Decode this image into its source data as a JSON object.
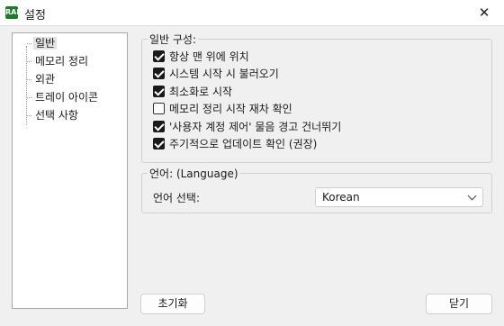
{
  "window": {
    "title": "설정",
    "app_icon_text": "RAM",
    "close_glyph": "✕"
  },
  "sidebar": {
    "items": [
      {
        "label": "일반",
        "selected": true
      },
      {
        "label": "메모리 정리",
        "selected": false
      },
      {
        "label": "외관",
        "selected": false
      },
      {
        "label": "트레이 아이콘",
        "selected": false
      },
      {
        "label": "선택 사항",
        "selected": false
      }
    ]
  },
  "general": {
    "legend": "일반 구성:",
    "options": [
      {
        "label": "항상 맨 위에 위치",
        "checked": true
      },
      {
        "label": "시스템 시작 시 불러오기",
        "checked": true
      },
      {
        "label": "최소화로 시작",
        "checked": true
      },
      {
        "label": "메모리 정리 시작 재차 확인",
        "checked": false
      },
      {
        "label": "'사용자 계정 제어' 물음 경고 건너뛰기",
        "checked": true
      },
      {
        "label": "주기적으로 업데이트 확인 (권장)",
        "checked": true
      }
    ]
  },
  "language": {
    "legend": "언어: (Language)",
    "label": "언어 선택:",
    "selected": "Korean"
  },
  "buttons": {
    "reset": "초기화",
    "close": "닫기"
  },
  "colors": {
    "window_bg": "#f0f0f0",
    "app_icon": "#1f7a2e"
  }
}
